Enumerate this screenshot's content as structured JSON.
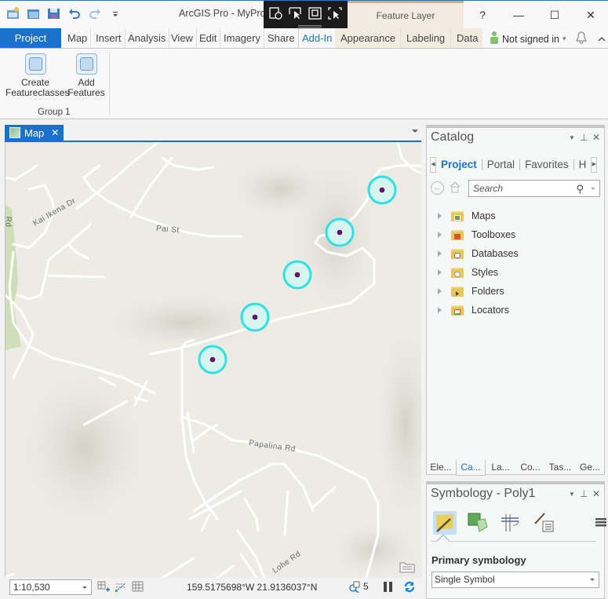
{
  "window": {
    "title": "ArcGIS Pro - MyProje",
    "contextual_tab_group": "Feature Layer",
    "controls": {
      "help": "?",
      "minimize": "—",
      "maximize": "☐",
      "close": "✕"
    }
  },
  "quick_access": [
    "new-project-icon",
    "open-project-icon",
    "save-project-icon",
    "undo-icon",
    "redo-icon",
    "customize-icon"
  ],
  "floating_toolbar": [
    "explore-icon",
    "select-icon",
    "zoom-extent-icon",
    "select-by-rect-icon"
  ],
  "ribbon_tabs": [
    {
      "label": "Project",
      "state": "project"
    },
    {
      "label": "Map"
    },
    {
      "label": "Insert"
    },
    {
      "label": "Analysis"
    },
    {
      "label": "View"
    },
    {
      "label": "Edit"
    },
    {
      "label": "Imagery"
    },
    {
      "label": "Share"
    },
    {
      "label": "Add-In",
      "state": "active"
    },
    {
      "label": "Appearance",
      "state": "contextual"
    },
    {
      "label": "Labeling",
      "state": "contextual"
    },
    {
      "label": "Data",
      "state": "contextual"
    }
  ],
  "user": {
    "signin_label": "Not signed in",
    "dropdown": "▾"
  },
  "ribbon": {
    "buttons": [
      {
        "label_line1": "Create",
        "label_line2": "Featureclasses"
      },
      {
        "label_line1": "Add",
        "label_line2": "Features"
      }
    ],
    "group_label": "Group 1"
  },
  "map_view": {
    "tab_label": "Map",
    "close": "✕",
    "labels": {
      "kai_ikena": "Kai Ikena Dr",
      "pai_st": "Pai St",
      "papalina": "Papalina Rd",
      "lohe": "Lohe Rd",
      "edge_rd": "Rd"
    },
    "points_count": 5,
    "point_colors": {
      "halo": "#2fe0e6",
      "fill": "#d6f5ee",
      "center": "#7a007a"
    }
  },
  "status_bar": {
    "scale": "1:10,530",
    "coordinates": "159.5175698°W 21.9136037°N",
    "selected_count": "5"
  },
  "catalog": {
    "title": "Catalog",
    "tabs": [
      "Project",
      "Portal",
      "Favorites",
      "H"
    ],
    "selected_tab": "Project",
    "search_placeholder": "Search",
    "items": [
      {
        "label": "Maps",
        "icon": "maps-folder-icon"
      },
      {
        "label": "Toolboxes",
        "icon": "toolboxes-folder-icon"
      },
      {
        "label": "Databases",
        "icon": "databases-folder-icon"
      },
      {
        "label": "Styles",
        "icon": "styles-folder-icon"
      },
      {
        "label": "Folders",
        "icon": "folders-folder-icon"
      },
      {
        "label": "Locators",
        "icon": "locators-folder-icon"
      }
    ]
  },
  "dock_tabs": [
    "Ele...",
    "Ca...",
    "La...",
    "Co...",
    "Tas...",
    "Ge..."
  ],
  "symbology": {
    "title": "Symbology - Poly1",
    "primary_label": "Primary symbology",
    "primary_value": "Single Symbol"
  },
  "colors": {
    "accent": "#1a73c9",
    "contextual_tab": "#f4ebe0",
    "contextual_border": "#f0a45c",
    "map_bg": "#ecebe4"
  }
}
